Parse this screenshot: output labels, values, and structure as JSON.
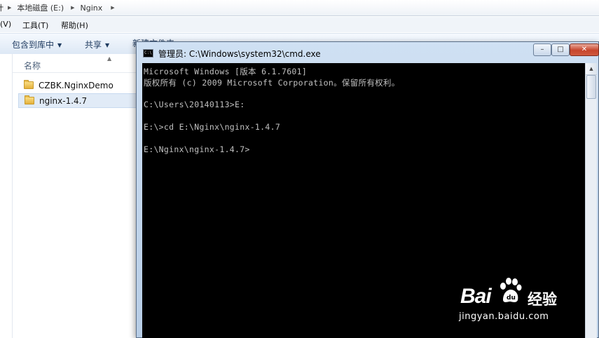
{
  "explorer": {
    "address": {
      "lead": "计",
      "crumbs": [
        "本地磁盘 (E:)",
        "Nginx"
      ]
    },
    "menu": [
      "(V)",
      "工具(T)",
      "帮助(H)"
    ],
    "toolbar": {
      "include_in_library": "包含到库中",
      "share": "共享",
      "new_folder": "新建文件夹"
    },
    "column_name": "名称",
    "files": [
      {
        "name": "CZBK.NginxDemo",
        "selected": false
      },
      {
        "name": "nginx-1.4.7",
        "selected": true
      }
    ]
  },
  "cmd": {
    "title": "管理员: C:\\Windows\\system32\\cmd.exe",
    "icon_text": "C:\\",
    "buttons": {
      "minimize": "–",
      "maximize": "□",
      "close": "✕"
    },
    "lines": [
      "Microsoft Windows [版本 6.1.7601]",
      "版权所有 (c) 2009 Microsoft Corporation。保留所有权利。",
      "",
      "C:\\Users\\20140113>E:",
      "",
      "E:\\>cd E:\\Nginx\\nginx-1.4.7",
      "",
      "E:\\Nginx\\nginx-1.4.7>"
    ]
  },
  "watermark": {
    "logo_left": "Bai",
    "logo_right": "经验",
    "url": "jingyan.baidu.com"
  }
}
